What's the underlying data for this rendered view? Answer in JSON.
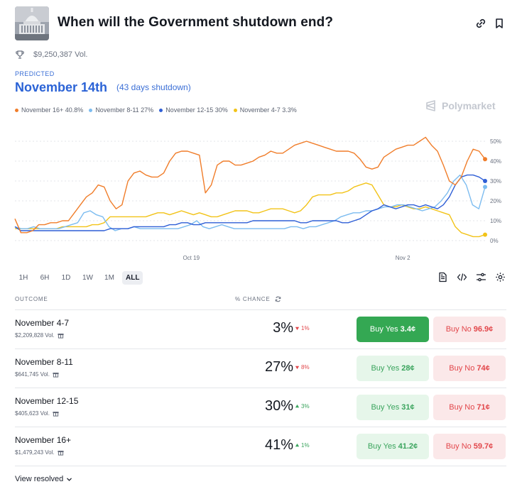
{
  "header": {
    "title": "When will the Government shutdown end?",
    "thumbnail_icon": "capitol-building-image",
    "link_icon": "link-icon",
    "bookmark_icon": "bookmark-icon"
  },
  "volume": {
    "icon": "trophy-icon",
    "text": "$9,250,387 Vol."
  },
  "predicted": {
    "label": "PREDICTED",
    "value": "November 14th",
    "sub": "(43 days shutdown)"
  },
  "brand": {
    "name": "Polymarket"
  },
  "legend": [
    {
      "label": "November 16+ 40.8%",
      "color": "#f07d2a"
    },
    {
      "label": "November 8-11 27%",
      "color": "#7cbcf0"
    },
    {
      "label": "November 12-15 30%",
      "color": "#2f5fd6"
    },
    {
      "label": "November 4-7 3.3%",
      "color": "#f2c318"
    }
  ],
  "chart_data": {
    "type": "line",
    "x_tick_labels": [
      "Oct 19",
      "Nov 2"
    ],
    "y_tick_labels": [
      "50%",
      "40%",
      "30%",
      "20%",
      "10%",
      "0%"
    ],
    "ylim": [
      0,
      50
    ],
    "grid": true,
    "x": [
      0,
      1,
      2,
      3,
      4,
      5,
      6,
      7,
      8,
      9,
      10,
      11,
      12,
      13,
      14,
      15,
      16,
      17,
      18,
      19,
      20,
      21,
      22,
      23,
      24,
      25,
      26,
      27,
      28,
      29,
      30,
      31,
      32,
      33,
      34,
      35,
      36,
      37,
      38,
      39,
      40,
      41,
      42,
      43,
      44,
      45,
      46,
      47,
      48,
      49,
      50,
      51,
      52,
      53,
      54,
      55,
      56,
      57,
      58,
      59,
      60,
      61,
      62,
      63,
      64,
      65,
      66,
      67,
      68,
      69,
      70,
      71,
      72,
      73,
      74,
      75,
      76,
      77,
      78,
      79,
      80,
      81,
      82,
      83,
      84,
      85,
      86,
      87,
      88,
      89,
      90,
      91,
      92,
      93,
      94,
      95,
      96,
      97,
      98,
      99
    ],
    "series": [
      {
        "name": "November 16+",
        "color": "#f07d2a",
        "values": [
          11,
          4,
          4,
          5,
          8,
          8,
          9,
          9,
          10,
          10,
          14,
          18,
          22,
          24,
          28,
          27,
          20,
          16,
          18,
          30,
          34,
          35,
          33,
          32,
          32,
          34,
          40,
          44,
          45,
          45,
          44,
          43,
          24,
          28,
          38,
          40,
          40,
          38,
          38,
          39,
          40,
          42,
          43,
          45,
          44,
          44,
          46,
          48,
          49,
          50,
          49,
          48,
          47,
          46,
          45,
          45,
          45,
          44,
          41,
          37,
          36,
          37,
          42,
          44,
          46,
          47,
          48,
          48,
          50,
          52,
          48,
          45,
          38,
          30,
          28,
          32,
          40,
          46,
          45,
          41
        ]
      },
      {
        "name": "November 8-11",
        "color": "#7cbcf0",
        "values": [
          7,
          6,
          6,
          7,
          6,
          6,
          6,
          6,
          7,
          8,
          9,
          14,
          15,
          13,
          12,
          7,
          5,
          6,
          6,
          7,
          6,
          6,
          6,
          6,
          6,
          6,
          6,
          7,
          8,
          10,
          7,
          6,
          7,
          8,
          7,
          6,
          6,
          6,
          6,
          6,
          6,
          6,
          6,
          6,
          7,
          7,
          6,
          7,
          7,
          8,
          9,
          10,
          12,
          13,
          14,
          14,
          15,
          15,
          16,
          17,
          17,
          18,
          18,
          17,
          16,
          15,
          16,
          17,
          20,
          24,
          30,
          33,
          28,
          18,
          16,
          27
        ]
      },
      {
        "name": "November 12-15",
        "color": "#2f5fd6",
        "values": [
          7,
          5,
          5,
          5,
          5,
          5,
          5,
          5,
          5,
          5,
          5,
          5,
          5,
          5,
          5,
          5,
          6,
          6,
          6,
          6,
          7,
          7,
          7,
          7,
          7,
          7,
          8,
          8,
          9,
          9,
          8,
          8,
          9,
          9,
          9,
          9,
          9,
          9,
          9,
          9,
          10,
          10,
          10,
          10,
          10,
          10,
          10,
          10,
          9,
          9,
          10,
          10,
          10,
          10,
          10,
          9,
          9,
          10,
          11,
          13,
          15,
          16,
          18,
          17,
          16,
          17,
          18,
          18,
          17,
          18,
          17,
          16,
          18,
          22,
          28,
          32,
          33,
          33,
          32,
          30
        ]
      },
      {
        "name": "November 4-7",
        "color": "#f2c318",
        "values": [
          6,
          6,
          6,
          6,
          6,
          6,
          6,
          6,
          7,
          7,
          7,
          7,
          7,
          8,
          8,
          9,
          12,
          12,
          12,
          12,
          12,
          12,
          12,
          13,
          14,
          14,
          13,
          14,
          15,
          14,
          13,
          14,
          13,
          12,
          12,
          13,
          14,
          15,
          15,
          15,
          14,
          14,
          15,
          16,
          16,
          16,
          15,
          14,
          15,
          18,
          22,
          23,
          23,
          23,
          24,
          24,
          25,
          27,
          28,
          29,
          28,
          23,
          18,
          17,
          17,
          18,
          17,
          16,
          16,
          17,
          16,
          15,
          14,
          13,
          7,
          4,
          3,
          2,
          2,
          3
        ]
      }
    ]
  },
  "range_tabs": [
    "1H",
    "6H",
    "1D",
    "1W",
    "1M",
    "ALL"
  ],
  "range_active": "ALL",
  "tools": [
    "document-icon",
    "code-icon",
    "sliders-icon",
    "gear-icon"
  ],
  "table": {
    "col_outcome": "OUTCOME",
    "col_chance": "% CHANCE",
    "rows": [
      {
        "name": "November 4-7",
        "vol": "$2,209,828 Vol.",
        "pct": "3%",
        "delta": "1%",
        "dir": "down",
        "yes_label": "Buy Yes",
        "yes_price": "3.4¢",
        "no_label": "Buy No",
        "no_price": "96.9¢"
      },
      {
        "name": "November 8-11",
        "vol": "$641,745 Vol.",
        "pct": "27%",
        "delta": "8%",
        "dir": "down",
        "yes_label": "Buy Yes",
        "yes_price": "28¢",
        "no_label": "Buy No",
        "no_price": "74¢"
      },
      {
        "name": "November 12-15",
        "vol": "$405,623 Vol.",
        "pct": "30%",
        "delta": "3%",
        "dir": "up",
        "yes_label": "Buy Yes",
        "yes_price": "31¢",
        "no_label": "Buy No",
        "no_price": "71¢"
      },
      {
        "name": "November 16+",
        "vol": "$1,479,243 Vol.",
        "pct": "41%",
        "delta": "1%",
        "dir": "up",
        "yes_label": "Buy Yes",
        "yes_price": "41.2¢",
        "no_label": "Buy No",
        "no_price": "59.7¢"
      }
    ]
  },
  "footer": {
    "view_resolved": "View resolved"
  }
}
